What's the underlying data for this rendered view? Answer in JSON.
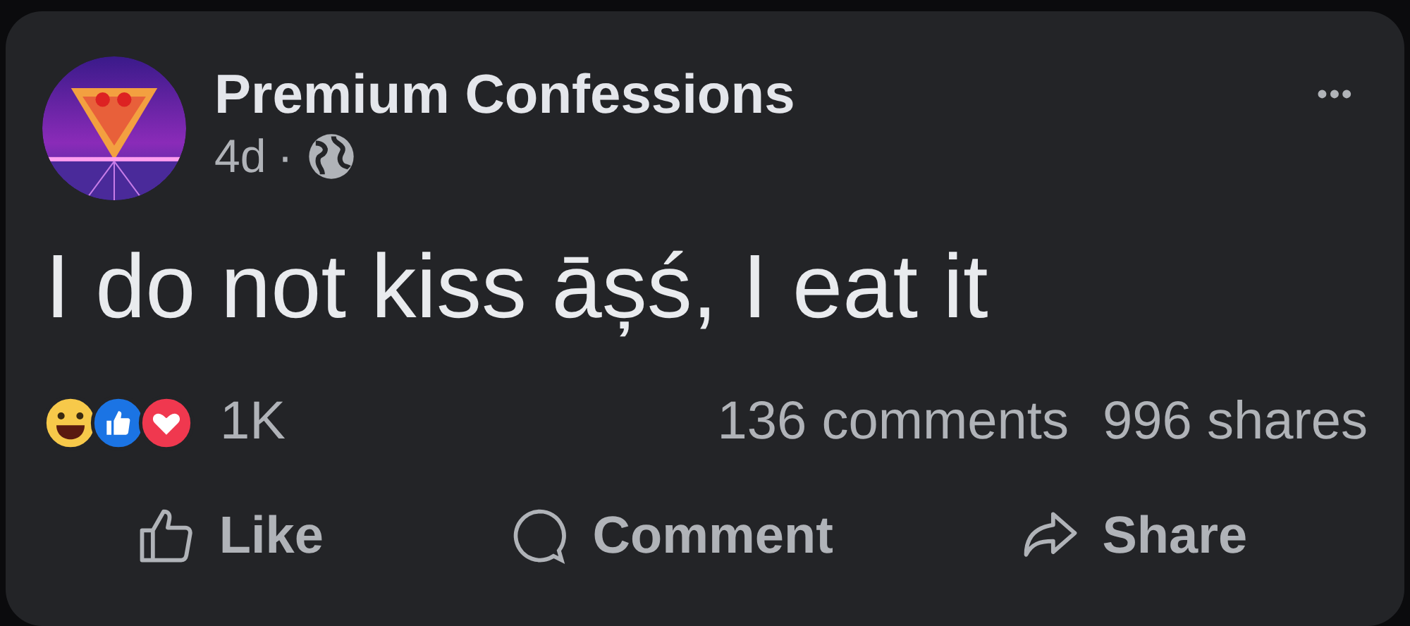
{
  "post": {
    "author": "Premium Confessions",
    "time": "4d",
    "separator": "·",
    "menu": "•••",
    "text": "I do not kiss āșś, I eat it"
  },
  "stats": {
    "reactions_count": "1K",
    "comments": "136 comments",
    "shares": "996 shares"
  },
  "actions": [
    {
      "kind": "like",
      "label": "Like"
    },
    {
      "kind": "comment",
      "label": "Comment"
    },
    {
      "kind": "share",
      "label": "Share"
    }
  ]
}
